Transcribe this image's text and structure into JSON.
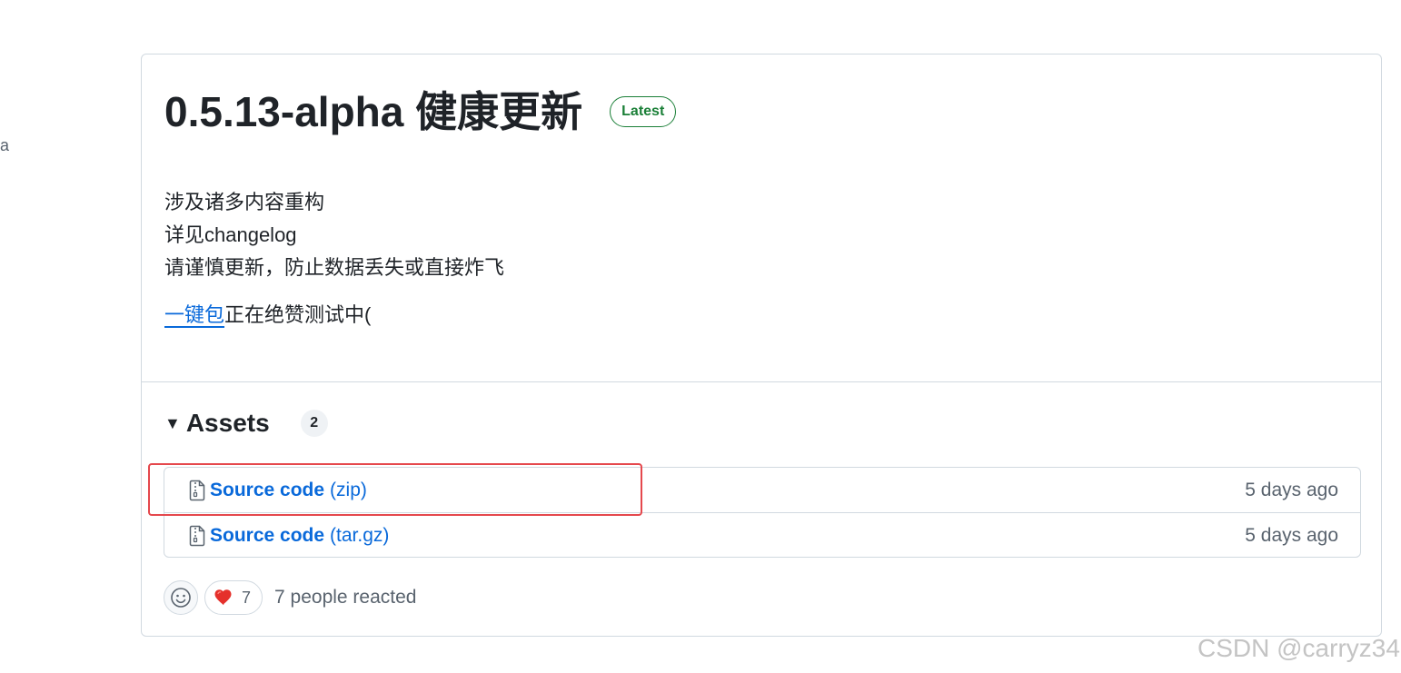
{
  "left_fragment": "a",
  "release": {
    "title": "0.5.13-alpha 健康更新",
    "badge": "Latest",
    "body_lines": [
      "涉及诸多内容重构",
      "详见changelog",
      "请谨慎更新，防止数据丢失或直接炸飞"
    ],
    "link_text": "一键包",
    "link_suffix": "正在绝赞测试中("
  },
  "assets": {
    "title": "Assets",
    "count": "2",
    "items": [
      {
        "name": "Source code",
        "ext": "(zip)",
        "date": "5 days ago"
      },
      {
        "name": "Source code",
        "ext": "(tar.gz)",
        "date": "5 days ago"
      }
    ]
  },
  "reactions": {
    "heart_count": "7",
    "summary": "7 people reacted"
  },
  "watermark": "CSDN @carryz34",
  "colors": {
    "link": "#0969da",
    "latest_badge": "#1a7f37",
    "highlight": "#e5484d"
  },
  "icons": [
    "file-zip-icon",
    "smiley-icon",
    "heart-icon",
    "triangle-down-icon"
  ]
}
